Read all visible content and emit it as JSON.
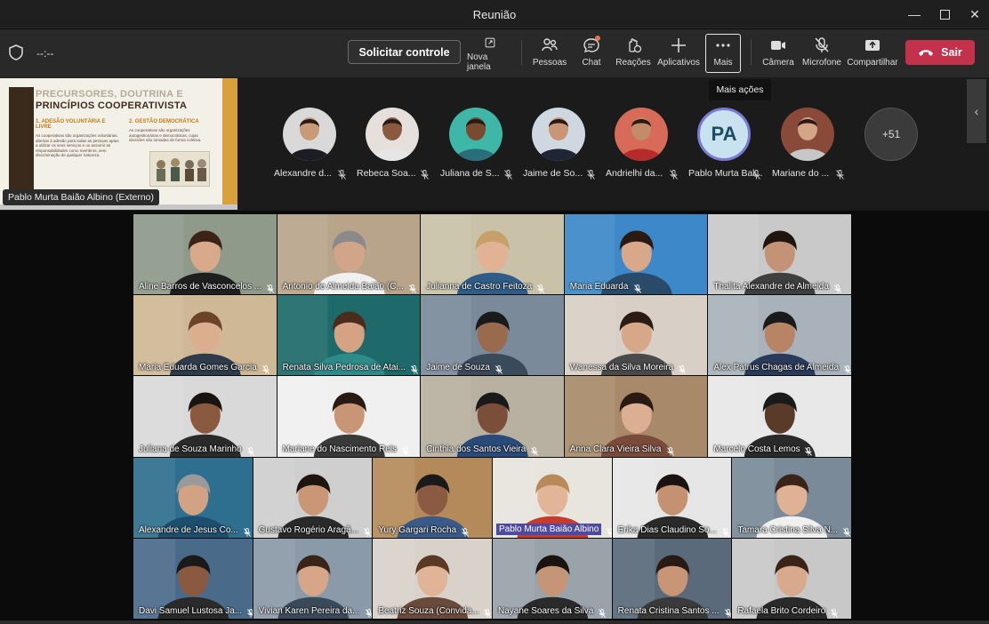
{
  "window": {
    "title": "Reunião"
  },
  "toolbar": {
    "timer": "--:--",
    "request_control": "Solicitar controle",
    "items": [
      {
        "label": "Nova janela",
        "icon": "new-window-icon"
      },
      {
        "label": "Pessoas",
        "icon": "people-icon"
      },
      {
        "label": "Chat",
        "icon": "chat-icon"
      },
      {
        "label": "Reações",
        "icon": "reactions-icon"
      },
      {
        "label": "Aplicativos",
        "icon": "plus-icon"
      },
      {
        "label": "Mais",
        "icon": "more-icon"
      },
      {
        "label": "Câmera",
        "icon": "camera-icon"
      },
      {
        "label": "Microfone",
        "icon": "mic-off-icon"
      },
      {
        "label": "Compartilhar",
        "icon": "share-icon"
      }
    ],
    "leave": "Sair",
    "tooltip": "Mais ações"
  },
  "share": {
    "presenter": "Pablo Murta Baião Albino (Externo)",
    "slide_title_1": "PRECURSORES, DOUTRINA E",
    "slide_title_2": "PRINCÍPIOS COOPERATIVISTA",
    "section_1": "1. ADESÃO VOLUNTÁRIA E LIVRE",
    "section_1_text": "As cooperativas são organizações voluntárias, abertas à adesão para todas as pessoas aptas a utilizar os seus serviços e ou assumir as responsabilidades como membros, sem discriminação de qualquer natureza.",
    "section_2": "2. GESTÃO DEMOCRÁTICA",
    "section_2_text": "As cooperativas são organizações autogestionárias e democráticas, cujas decisões são tomadas de forma coletiva."
  },
  "strip": [
    {
      "name": "Alexandre d...",
      "skin": "#c99a78",
      "bg": "#d9d9d9",
      "cloth": "#1c1c24"
    },
    {
      "name": "Rebeca Soa...",
      "skin": "#8a5a40",
      "bg": "#e5e0dc",
      "cloth": "#e6e6e6"
    },
    {
      "name": "Juliana de S...",
      "skin": "#7a4a30",
      "bg": "#3fb7a8",
      "cloth": "#2a6e7a"
    },
    {
      "name": "Jaime de So...",
      "skin": "#c89577",
      "bg": "#cfd8e0",
      "cloth": "#1e2636"
    },
    {
      "name": "Andrielhi da...",
      "skin": "#c28b6a",
      "bg": "#d86a5a",
      "cloth": "#b62c2c"
    },
    {
      "name": "Pablo Murta Bai...",
      "initials": "PA"
    },
    {
      "name": "Mariane do ...",
      "skin": "#d5a588",
      "bg": "#8a4a3a",
      "cloth": "#c7c7c7"
    },
    {
      "more": "+51"
    }
  ],
  "grid": [
    [
      "Aline Barros de Vasconcelos ...",
      "Antonio de Almeida Baião (C...",
      "Julianna de Castro Feitoza",
      "Maria Eduarda",
      "Thalita Alexandre de Almeida"
    ],
    [
      "Maria Eduarda Gomes Garcia",
      "Renata  Silva Pedrosa de Atai...",
      "Jaime de Souza",
      "Wanessa da Silva Moreira",
      "Alex Patrus Chagas de Almeida"
    ],
    [
      "Juliana de Souza Marinho",
      "Mariane do Nascimento Reis",
      "Cinthia dos Santos Vieira",
      "Anna Clara Vieira Silva",
      "Marcelo Costa Lemos"
    ],
    [
      "Alexandre de Jesus Co...",
      "Gustavo Rogério Aragã...",
      "Yury Gargari Rocha",
      "Pablo Murta Baião Albino",
      "Erika Dias Claudino So...",
      "Tamara Cristina Silva N..."
    ],
    [
      "Davi Samuel Lustosa Ja...",
      "Vivian Karen Pereira da...",
      "Beatriz Souza (Convida...",
      "Nayane Soares da Silva",
      "Renata Cristina Santos ...",
      "Rafaela Brito Cordeiro"
    ]
  ],
  "tile_style": [
    [
      {
        "bg": "#8f9a8a",
        "skin": "#d8a98a",
        "hair": "#3b2416",
        "cloth": "#1f1f1f"
      },
      {
        "bg": "#b8a48a",
        "skin": "#d2a58a",
        "hair": "#8a8a8a",
        "cloth": "#f0f0f0"
      },
      {
        "bg": "#c9c2a8",
        "skin": "#e1b293",
        "hair": "#c6a06a",
        "cloth": "#2f5d88"
      },
      {
        "bg": "#3c88c8",
        "skin": "#d9a88a",
        "hair": "#2a1a12",
        "cloth": "#2a4a6a"
      },
      {
        "bg": "#c9c9c9",
        "skin": "#c49276",
        "hair": "#1e1410",
        "cloth": "#3f3f3f"
      }
    ],
    [
      {
        "bg": "#cfb895",
        "skin": "#dcae90",
        "hair": "#6b4427",
        "cloth": "#2f3a4a"
      },
      {
        "bg": "#1e6a6a",
        "skin": "#d6a284",
        "hair": "#4a2c1c",
        "cloth": "#2f8a8a"
      },
      {
        "bg": "#7a8a9a",
        "skin": "#9a6a4e",
        "hair": "#1a1a1a",
        "cloth": "#3a4a5a"
      },
      {
        "bg": "#d8d0c6",
        "skin": "#d7a78a",
        "hair": "#2a1b14",
        "cloth": "#4a4a4a"
      },
      {
        "bg": "#a9b2ba",
        "skin": "#b88466",
        "hair": "#1a1a1a",
        "cloth": "#2a3a5a"
      }
    ],
    [
      {
        "bg": "#d9d9d9",
        "skin": "#8a5a40",
        "hair": "#1a1410",
        "cloth": "#2a2a2a"
      },
      {
        "bg": "#f0f0f0",
        "skin": "#c89677",
        "hair": "#2a1a14",
        "cloth": "#3a3a3a"
      },
      {
        "bg": "#b8b0a0",
        "skin": "#7a4e38",
        "hair": "#1a1a1a",
        "cloth": "#2a4a7a"
      },
      {
        "bg": "#a88a6a",
        "skin": "#dcae92",
        "hair": "#2a1a12",
        "cloth": "#7a4a3a"
      },
      {
        "bg": "#e8e8e8",
        "skin": "#5a3a28",
        "hair": "#1a1a1a",
        "cloth": "#2a2a2a"
      }
    ],
    [
      {
        "bg": "#2e6e8e",
        "skin": "#d2a284",
        "hair": "#9a9a9a",
        "cloth": "#1e4e6e"
      },
      {
        "bg": "#cfcfcf",
        "skin": "#c99676",
        "hair": "#1e1410",
        "cloth": "#2a2a2a"
      },
      {
        "bg": "#b58a5a",
        "skin": "#8a5a42",
        "hair": "#1a1a1a",
        "cloth": "#3a5a8a"
      },
      {
        "bg": "#e8e4de",
        "skin": "#e2b599",
        "hair": "#b88a5a",
        "cloth": "#c83a2a"
      },
      {
        "bg": "#e6e6e6",
        "skin": "#c49272",
        "hair": "#1a1210",
        "cloth": "#2a2a2a"
      },
      {
        "bg": "#7a8a98",
        "skin": "#e0b295",
        "hair": "#3a2418",
        "cloth": "#f0f0f0"
      }
    ],
    [
      {
        "bg": "#4a6a8a",
        "skin": "#8a5a40",
        "hair": "#1a1a1a",
        "cloth": "#2a2a2a"
      },
      {
        "bg": "#8a9aa8",
        "skin": "#d7a689",
        "hair": "#3a2418",
        "cloth": "#3a4a5a"
      },
      {
        "bg": "#d8d2ca",
        "skin": "#e1b397",
        "hair": "#5a3a24",
        "cloth": "#6a4a3a"
      },
      {
        "bg": "#9aa2aa",
        "skin": "#c69476",
        "hair": "#1a1410",
        "cloth": "#2a2a2a"
      },
      {
        "bg": "#5a6a7a",
        "skin": "#c89576",
        "hair": "#2a1a14",
        "cloth": "#3a3a3a"
      },
      {
        "bg": "#c8c8c8",
        "skin": "#d8a98c",
        "hair": "#3a2418",
        "cloth": "#2a2a2a"
      }
    ]
  ]
}
